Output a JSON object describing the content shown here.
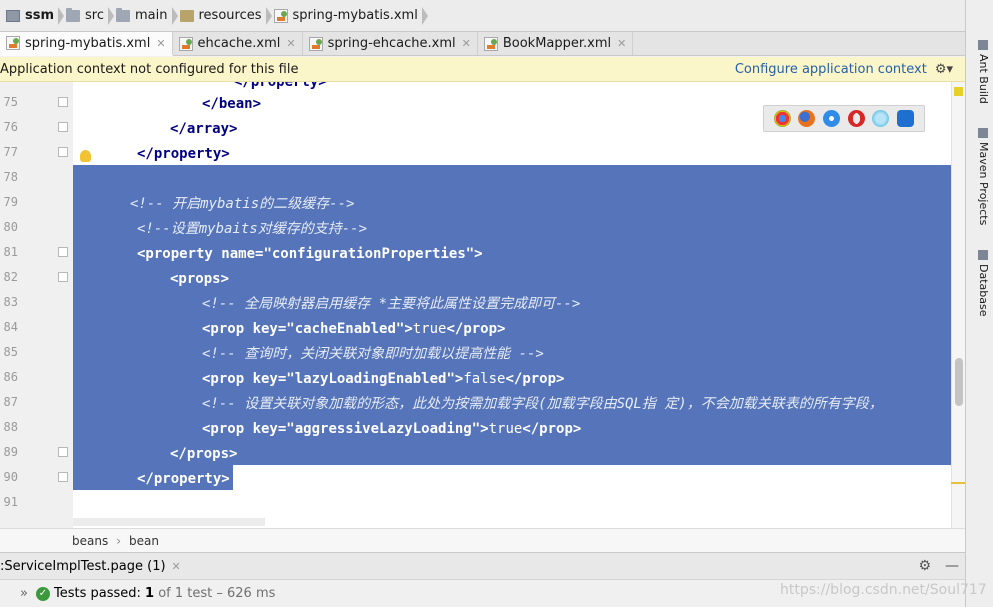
{
  "breadcrumb": [
    "ssm",
    "src",
    "main",
    "resources",
    "spring-mybatis.xml"
  ],
  "tabs": [
    {
      "label": "spring-mybatis.xml",
      "active": true
    },
    {
      "label": "ehcache.xml",
      "active": false
    },
    {
      "label": "spring-ehcache.xml",
      "active": false
    },
    {
      "label": "BookMapper.xml",
      "active": false
    }
  ],
  "banner": {
    "message": "Application context not configured for this file",
    "action": "Configure application context"
  },
  "editor": {
    "line_numbers": [
      "75",
      "76",
      "77",
      "78",
      "79",
      "80",
      "81",
      "82",
      "83",
      "84",
      "85",
      "86",
      "87",
      "88",
      "89",
      "90",
      "91"
    ],
    "top_partial": "</property>",
    "lines": {
      "l75": "</bean>",
      "l76": "</array>",
      "l77": "</property>",
      "l79_cm": "<!-- 开启mybatis的二级缓存-->",
      "l80_cm": "<!--设置mybaits对缓存的支持-->",
      "l81_open": "<property ",
      "l81_attr": "name=",
      "l81_val": "\"configurationProperties\"",
      "l81_close": ">",
      "l82": "<props>",
      "l83_cm": "<!-- 全局映射器启用缓存 *主要将此属性设置完成即可-->",
      "l84_open": "<prop ",
      "l84_attr": "key=",
      "l84_val": "\"cacheEnabled\"",
      "l84_text": "true",
      "l84_close": "</prop>",
      "l85_cm": "<!-- 查询时，关闭关联对象即时加载以提高性能 -->",
      "l86_val": "\"lazyLoadingEnabled\"",
      "l86_text": "false",
      "l87_cm": "<!-- 设置关联对象加载的形态，此处为按需加载字段(加载字段由SQL指 定)，不会加载关联表的所有字段，",
      "l88_val": "\"aggressiveLazyLoading\"",
      "l88_text": "true",
      "l89": "</props>",
      "l90": "</property>"
    }
  },
  "editor_breadcrumb": [
    "beans",
    "bean"
  ],
  "run_panel": {
    "tab_label": ":ServiceImplTest.page (1)"
  },
  "status": {
    "prefix": "Tests passed:",
    "count": "1",
    "suffix": "of 1 test – 626 ms"
  },
  "right_tools": [
    "Ant Build",
    "Maven Projects",
    "Database"
  ],
  "watermark": "https://blog.csdn.net/Soul717",
  "colors": {
    "selection": "#5674b9",
    "banner": "#fbf6c9",
    "link": "#2760a8"
  }
}
